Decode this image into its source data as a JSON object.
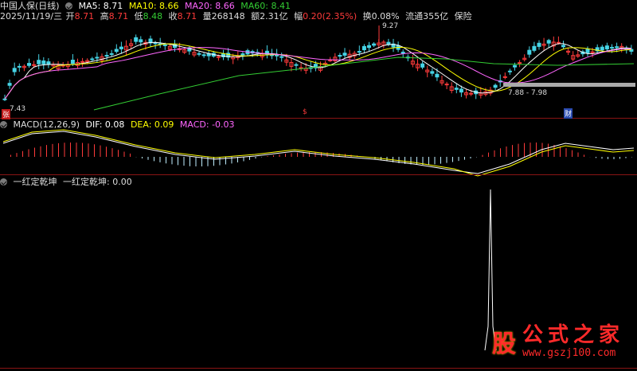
{
  "header": {
    "title": "中国人保(日线)",
    "ma5": "MA5: 8.71",
    "ma10": "MA10: 8.66",
    "ma20": "MA20: 8.66",
    "ma60": "MA60: 8.41",
    "date": "2025/11/19/三",
    "open_lbl": "开",
    "open": "8.71",
    "high_lbl": "高",
    "high": "8.71",
    "low_lbl": "低",
    "low": "8.48",
    "close_lbl": "收",
    "close": "8.71",
    "vol_lbl": "量",
    "vol": "268148",
    "amt_lbl": "额",
    "amt": "2.31亿",
    "chg_lbl": "幅",
    "chg": "0.20(2.35%)",
    "turnover": "换0.08%",
    "float_cap": "流通355亿",
    "industry": "保险"
  },
  "price_panel": {
    "max_label": "9.27",
    "min_label": "7.43",
    "range_label": "7.88 - 7.98",
    "marker_zhang": "张",
    "marker_s": "$",
    "marker_cai": "财"
  },
  "macd": {
    "label": "MACD(12,26,9)",
    "dif": "DIF: 0.08",
    "dea": "DEA: 0.09",
    "macd": "MACD: -0.03"
  },
  "indicator": {
    "name": "一红定乾坤",
    "value": "一红定乾坤: 0.00"
  },
  "watermark": {
    "logo": "股",
    "title": "公式之家",
    "url": "www.gszj100.com"
  },
  "colors": {
    "up": "#ff3b3b",
    "down": "#46d4e6",
    "ma5": "#ffffff",
    "ma10": "#ffff00",
    "ma20": "#ff66ff",
    "ma60": "#33cc33",
    "divider": "#8a1414"
  }
}
